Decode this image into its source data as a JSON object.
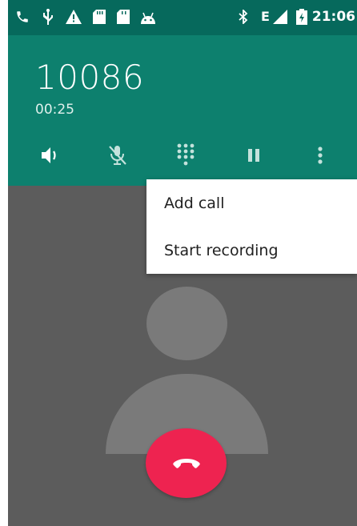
{
  "status_bar": {
    "time": "21:06",
    "network_type": "E",
    "icons": [
      "phone-icon",
      "usb-icon",
      "warning-icon",
      "sd-card-icon",
      "sd-card-icon",
      "android-icon",
      "bluetooth-icon",
      "signal-icon",
      "battery-charging-icon"
    ]
  },
  "call": {
    "number": "10086",
    "duration": "00:25"
  },
  "controls": [
    "speaker-icon",
    "mute-icon",
    "dialpad-icon",
    "hold-icon",
    "more-options-icon"
  ],
  "menu": {
    "add_call": "Add call",
    "start_recording": "Start recording"
  },
  "colors": {
    "status_bar": "#06695c",
    "header": "#0d806e",
    "background": "#5c5c5c",
    "end_call": "#ee2350"
  }
}
